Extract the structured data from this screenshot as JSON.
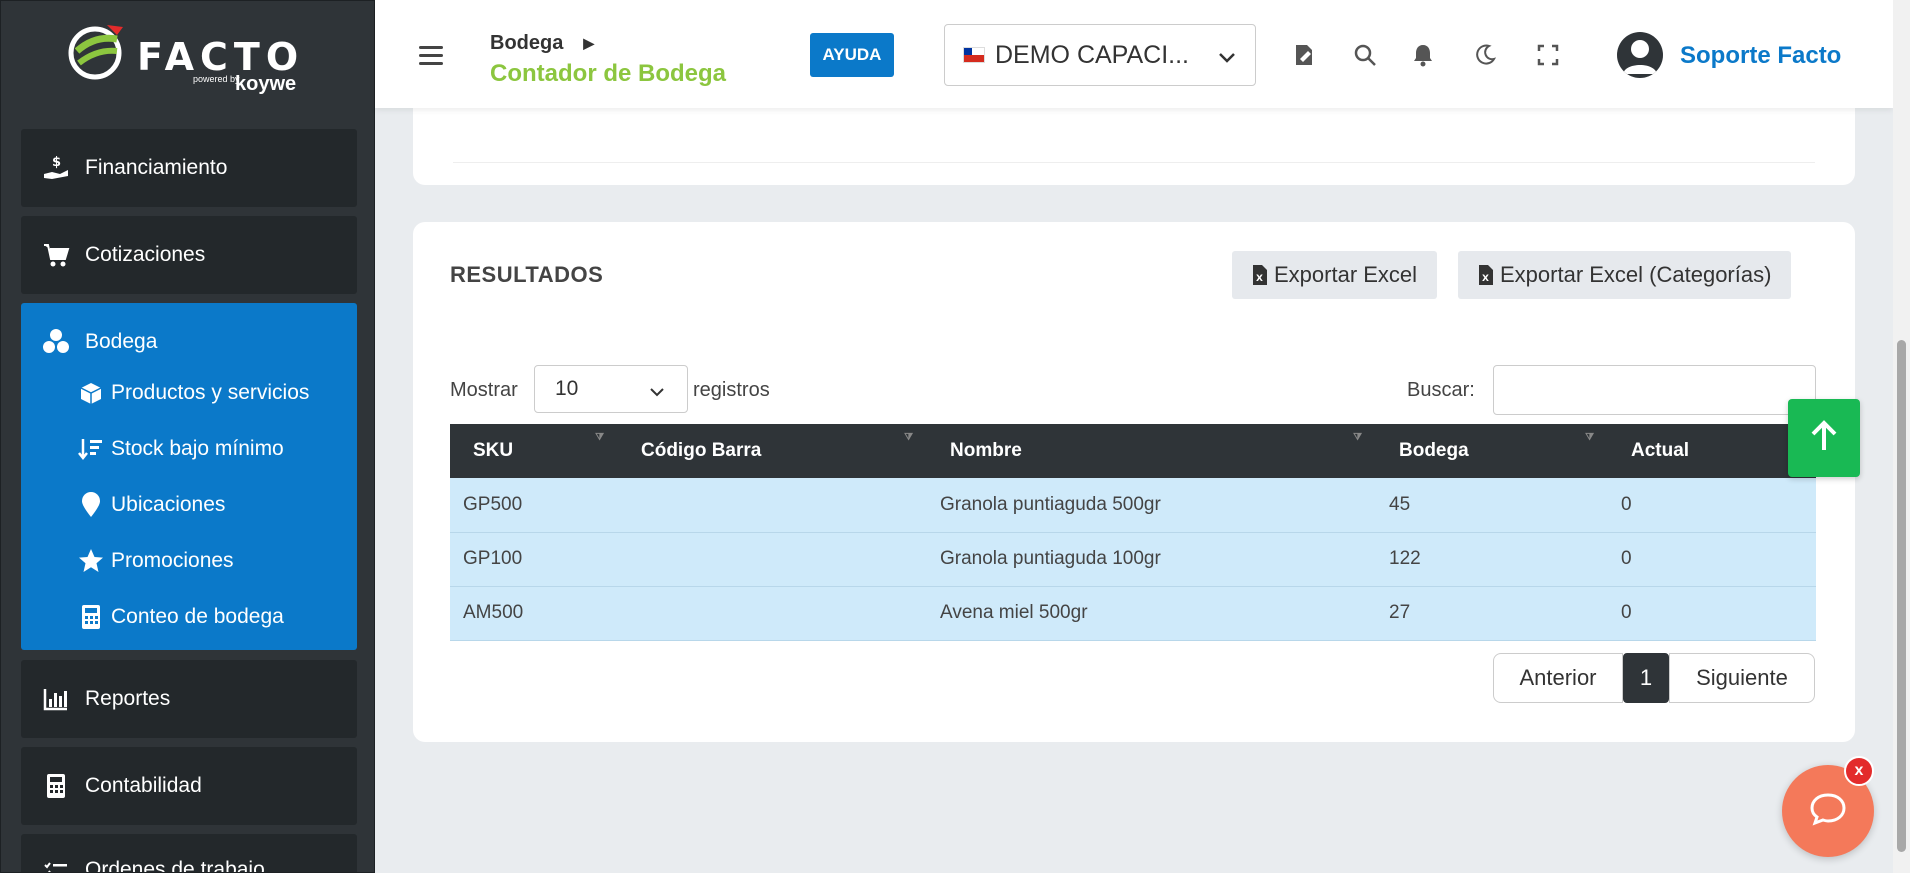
{
  "sidebar": {
    "logo": {
      "brand": "FACTO",
      "powered": "powered by",
      "partner": "koywe"
    },
    "items": [
      {
        "label": "Financiamiento",
        "icon": "hand-dollar-icon"
      },
      {
        "label": "Cotizaciones",
        "icon": "cart-icon"
      },
      {
        "label": "Bodega",
        "icon": "boxes-icon"
      },
      {
        "label": "Reportes",
        "icon": "bar-chart-icon"
      },
      {
        "label": "Contabilidad",
        "icon": "calculator-icon"
      },
      {
        "label": "Ordenes de trabajo",
        "icon": "list-check-icon"
      }
    ],
    "subitems": [
      {
        "label": "Productos y servicios",
        "icon": "box-icon"
      },
      {
        "label": "Stock bajo mínimo",
        "icon": "sort-down-icon"
      },
      {
        "label": "Ubicaciones",
        "icon": "map-pin-icon"
      },
      {
        "label": "Promociones",
        "icon": "star-icon"
      },
      {
        "label": "Conteo de bodega",
        "icon": "calculator-icon"
      }
    ]
  },
  "header": {
    "breadcrumb": "Bodega",
    "title": "Contador de Bodega",
    "help_label": "AYUDA",
    "company": "DEMO CAPACI...",
    "user_name": "Soporte Facto"
  },
  "results": {
    "title": "RESULTADOS",
    "export_label": "Exportar Excel",
    "export_categories_label": "Exportar Excel (Categorías)",
    "show_label": "Mostrar",
    "page_length": "10",
    "records_label": "registros",
    "search_label": "Buscar:",
    "search_value": "",
    "columns": [
      "SKU",
      "Código Barra",
      "Nombre",
      "Bodega",
      "Actual"
    ],
    "rows": [
      {
        "sku": "GP500",
        "barcode": "",
        "name": "Granola puntiaguda 500gr",
        "bodega": "45",
        "actual": "0"
      },
      {
        "sku": "GP100",
        "barcode": "",
        "name": "Granola puntiaguda 100gr",
        "bodega": "122",
        "actual": "0"
      },
      {
        "sku": "AM500",
        "barcode": "",
        "name": "Avena miel 500gr",
        "bodega": "27",
        "actual": "0"
      }
    ],
    "pagination": {
      "prev": "Anterior",
      "current": "1",
      "next": "Siguiente"
    }
  },
  "chat": {
    "close_label": "x"
  },
  "colors": {
    "sidebar_bg": "#2f3438",
    "active_blue": "#0b79c9",
    "brand_green": "#8cc63f",
    "row_blue": "#cfeafa",
    "scroll_green": "#19b954",
    "chat_orange": "#f4795a"
  }
}
